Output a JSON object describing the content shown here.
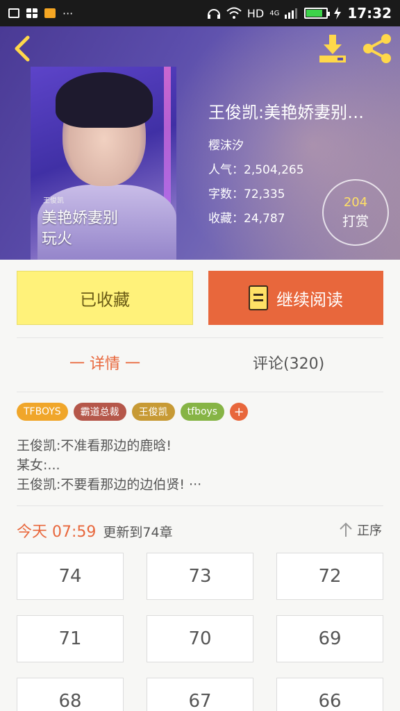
{
  "status_bar": {
    "network": "HD",
    "signal_label": "4G",
    "time": "17:32",
    "more": "···",
    "battery_color": "#3dd34a"
  },
  "header": {
    "back_icon": "chevron-left-icon",
    "download_icon": "download-icon",
    "share_icon": "share-icon",
    "cover": {
      "subtitle": "王俊凯",
      "title": "美艳娇妻别玩火"
    },
    "book_title": "王俊凯:美艳娇妻别…",
    "author": "樱沫汐",
    "popularity": "人气：2,504,265",
    "word_count": "字数：72,335",
    "favorites": "收藏：24,787",
    "tip": {
      "count": "204",
      "label": "打赏"
    }
  },
  "actions": {
    "favorited_label": "已收藏",
    "continue_label": "继续阅读",
    "accent_color": "#e8673c",
    "fav_color": "#fff27a"
  },
  "tabs": {
    "detail": "一 详情 一",
    "comments": "评论(320)"
  },
  "tags": [
    {
      "label": "TFBOYS",
      "color": "#f0a62a"
    },
    {
      "label": "霸道总裁",
      "color": "#b5574a"
    },
    {
      "label": "王俊凯",
      "color": "#c79a35"
    },
    {
      "label": "tfboys",
      "color": "#86b445"
    }
  ],
  "tag_add": "+",
  "description": {
    "line1": "王俊凯:不准看那边的鹿晗!",
    "line2": "某女:...",
    "line3": "王俊凯:不要看那边的边伯贤! ···"
  },
  "update": {
    "today": "今天 07:59",
    "text": "更新到74章"
  },
  "sort": {
    "label": "正序",
    "icon": "arrow-up-icon"
  },
  "chapters": [
    "74",
    "73",
    "72",
    "71",
    "70",
    "69",
    "68",
    "67",
    "66"
  ]
}
